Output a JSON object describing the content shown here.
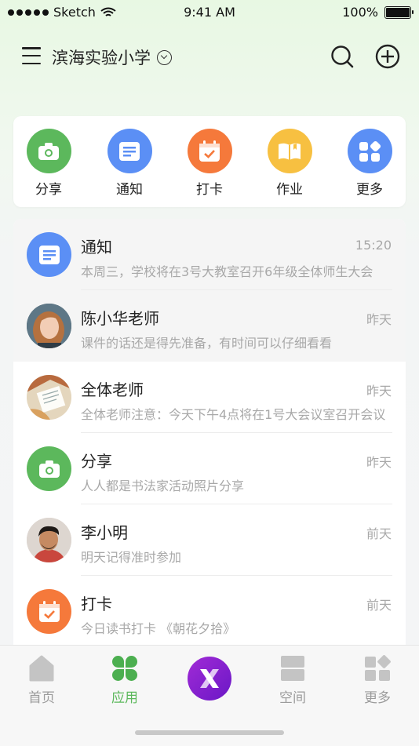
{
  "status": {
    "carrier": "Sketch",
    "time": "9:41 AM",
    "battery": "100%"
  },
  "header": {
    "school": "滨海实验小学"
  },
  "quick": [
    {
      "label": "分享",
      "icon": "camera-icon",
      "color": "#5cb85c"
    },
    {
      "label": "通知",
      "icon": "notice-icon",
      "color": "#5b8ff5"
    },
    {
      "label": "打卡",
      "icon": "calendar-check-icon",
      "color": "#f5793b"
    },
    {
      "label": "作业",
      "icon": "book-icon",
      "color": "#f7c041"
    },
    {
      "label": "更多",
      "icon": "grid-icon",
      "color": "#5b8ff5"
    }
  ],
  "messages": [
    {
      "title": "通知",
      "time": "15:20",
      "sub": "本周三，学校将在3号大教室召开6年级全体师生大会"
    },
    {
      "title": "陈小华老师",
      "time": "昨天",
      "sub": "课件的话还是得先准备，有时间可以仔细看看"
    },
    {
      "title": "全体老师",
      "time": "昨天",
      "sub": "全体老师注意：今天下午4点将在1号大会议室召开会议"
    },
    {
      "title": "分享",
      "time": "昨天",
      "sub": "人人都是书法家活动照片分享"
    },
    {
      "title": "李小明",
      "time": "前天",
      "sub": "明天记得准时参加"
    },
    {
      "title": "打卡",
      "time": "前天",
      "sub": "今日读书打卡 《朝花夕拾》"
    }
  ],
  "tabs": [
    {
      "label": "首页",
      "icon": "home-icon"
    },
    {
      "label": "应用",
      "icon": "clover-icon"
    },
    {
      "label": "",
      "icon": "x-logo-icon"
    },
    {
      "label": "空间",
      "icon": "space-icon"
    },
    {
      "label": "更多",
      "icon": "more-grid-icon"
    }
  ],
  "colors": {
    "accent": "#5cb85c",
    "brand_purple": "#8a22d0"
  }
}
